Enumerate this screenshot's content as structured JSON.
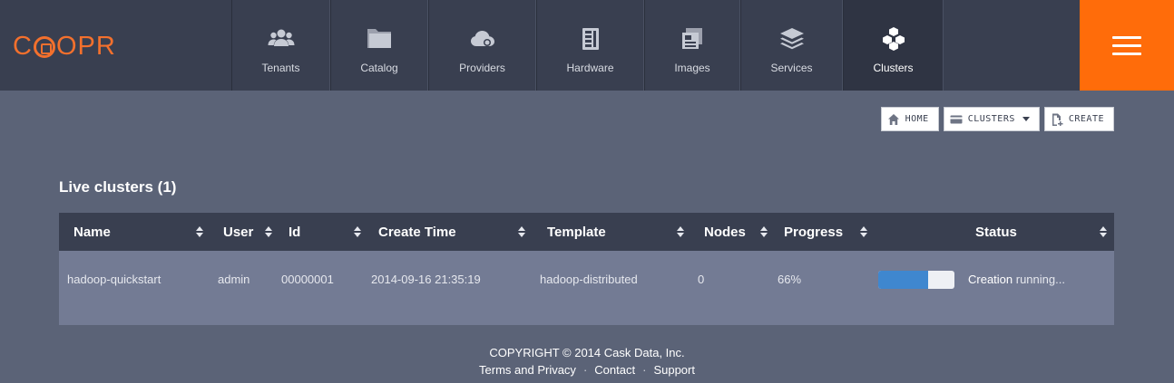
{
  "brand": {
    "text_before": "C",
    "text_after": "OPR",
    "color": "#f3702d"
  },
  "nav": {
    "items": [
      {
        "label": "Tenants",
        "icon": "users-icon"
      },
      {
        "label": "Catalog",
        "icon": "folder-icon"
      },
      {
        "label": "Providers",
        "icon": "cloud-icon"
      },
      {
        "label": "Hardware",
        "icon": "server-icon"
      },
      {
        "label": "Images",
        "icon": "image-icon"
      },
      {
        "label": "Services",
        "icon": "layers-icon"
      },
      {
        "label": "Clusters",
        "icon": "cubes-icon",
        "active": true
      }
    ],
    "menu_color": "#ff6c0a"
  },
  "toolbar": {
    "home_label": "HOME",
    "clusters_label": "CLUSTERS",
    "create_label": "CREATE"
  },
  "section_title": "Live clusters (1)",
  "table": {
    "headers": [
      "Name",
      "User",
      "Id",
      "Create Time",
      "Template",
      "Nodes",
      "Progress",
      "Status"
    ],
    "rows": [
      {
        "name": "hadoop-quickstart",
        "user": "admin",
        "id": "00000001",
        "create_time": "2014-09-16 21:35:19",
        "template": "hadoop-distributed",
        "nodes": "0",
        "progress": "66%",
        "progress_fraction": 0.66,
        "status_strong": "Creation",
        "status_rest": " running..."
      }
    ]
  },
  "footer": {
    "copyright": "COPYRIGHT © 2014 Cask Data, Inc.",
    "links": [
      "Terms and Privacy",
      "Contact",
      "Support"
    ],
    "separator": "·"
  }
}
